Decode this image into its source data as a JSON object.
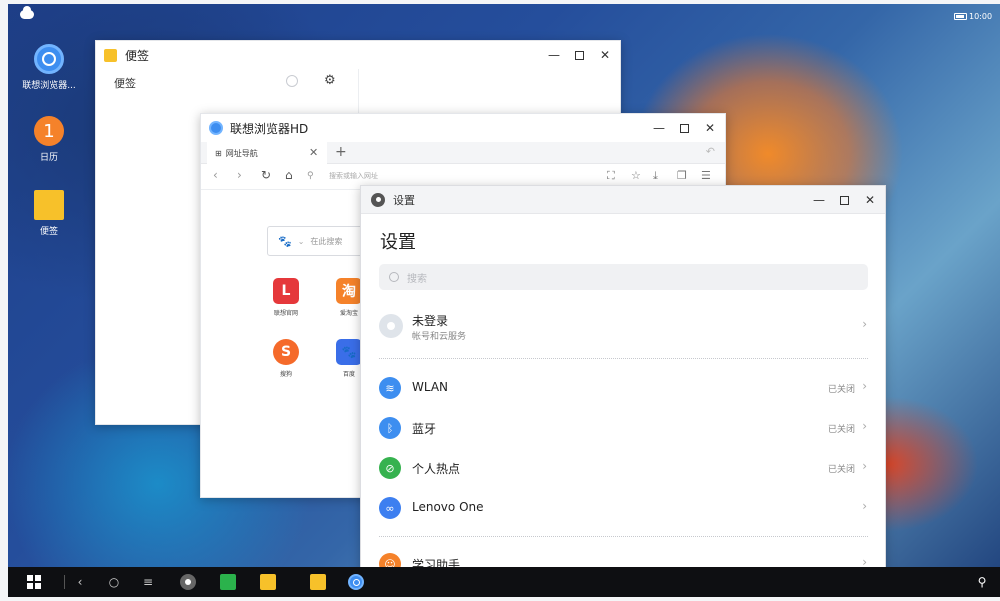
{
  "status_bar": {
    "time": "10:00"
  },
  "desktop": {
    "icons": [
      {
        "label": "联想浏览器..."
      },
      {
        "label": "日历",
        "badge": "1"
      },
      {
        "label": "便签"
      }
    ]
  },
  "notes_window": {
    "title": "便签",
    "header": "便签",
    "controls": {
      "minimize": "—",
      "close": "✕"
    }
  },
  "browser_window": {
    "title": "联想浏览器HD",
    "tab_label": "网址导航",
    "tab_close": "✕",
    "tab_add": "+",
    "url_placeholder": "搜索或输入网址",
    "search_placeholder": "在此搜索",
    "sites": [
      {
        "label": "联想官网",
        "glyph": "L",
        "color": "#e5383b"
      },
      {
        "label": "爱淘宝",
        "glyph": "淘",
        "color": "#f5822a"
      },
      {
        "label": "搜狗",
        "glyph": "S",
        "color": "#f56a2a"
      },
      {
        "label": "百度",
        "glyph": "🐾",
        "color": "#3a6ee8"
      }
    ],
    "controls": {
      "minimize": "—",
      "close": "✕"
    }
  },
  "settings_window": {
    "title": "设置",
    "heading": "设置",
    "search_placeholder": "搜索",
    "account": {
      "label": "未登录",
      "sub": "帐号和云服务"
    },
    "rows": [
      {
        "label": "WLAN",
        "status": "已关闭",
        "icon": "wifi-icon",
        "color": "#3d8ef0"
      },
      {
        "label": "蓝牙",
        "status": "已关闭",
        "icon": "bluetooth-icon",
        "color": "#3d8ef0"
      },
      {
        "label": "个人热点",
        "status": "已关闭",
        "icon": "hotspot-icon",
        "color": "#36b24f"
      },
      {
        "label": "Lenovo One",
        "status": "",
        "icon": "lenovo-one-icon",
        "color": "#3d7ff0"
      },
      {
        "label": "学习助手",
        "status": "",
        "icon": "study-assistant-icon",
        "color": "#f5822a"
      }
    ],
    "controls": {
      "minimize": "—",
      "close": "✕"
    }
  },
  "taskbar": {
    "back": "‹",
    "home": "○",
    "menu": "≡",
    "search": "⚲"
  }
}
